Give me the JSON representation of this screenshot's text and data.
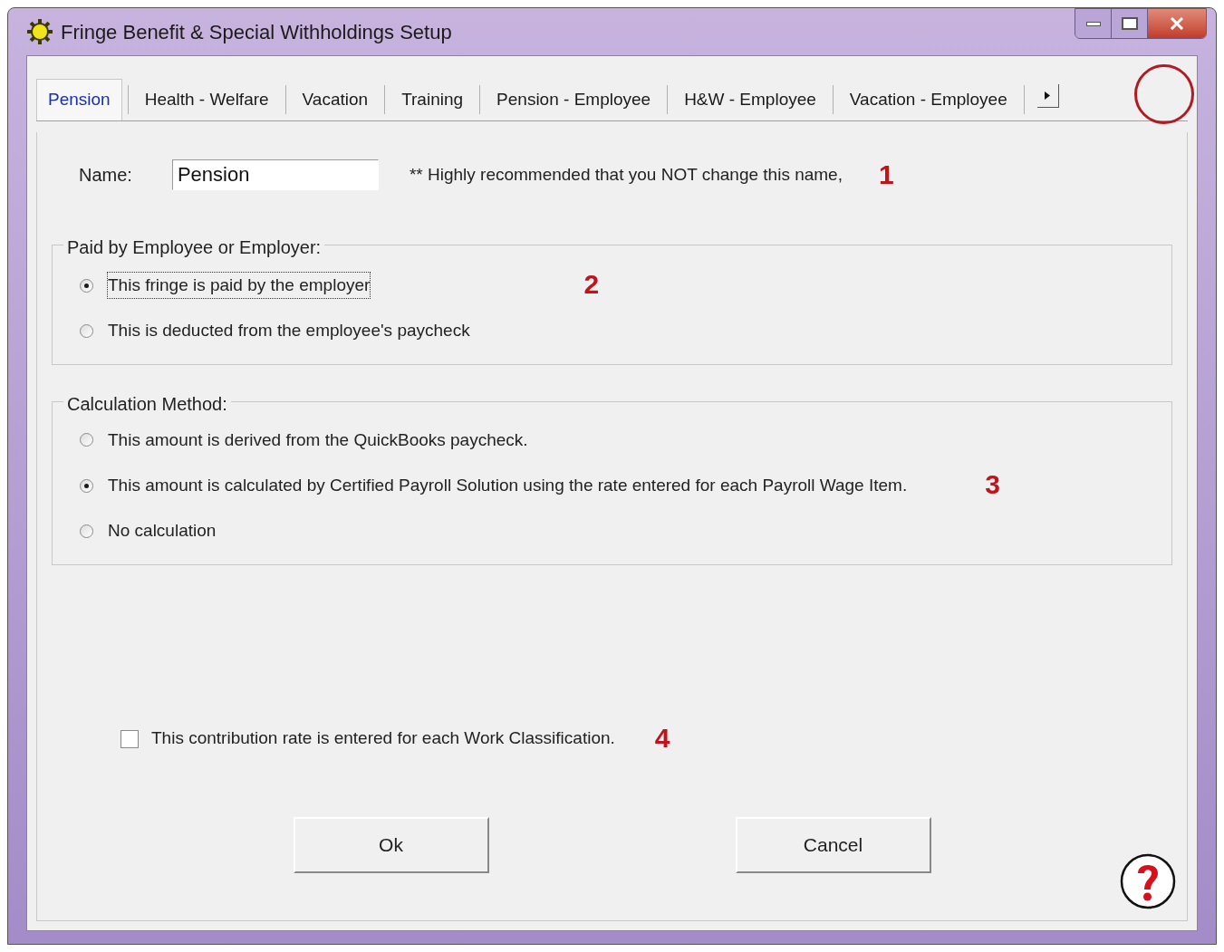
{
  "window": {
    "title": "Fringe Benefit & Special Withholdings Setup"
  },
  "tabs": [
    {
      "label": "Pension",
      "selected": true
    },
    {
      "label": "Health - Welfare",
      "selected": false
    },
    {
      "label": "Vacation",
      "selected": false
    },
    {
      "label": "Training",
      "selected": false
    },
    {
      "label": "Pension - Employee",
      "selected": false
    },
    {
      "label": "H&W - Employee",
      "selected": false
    },
    {
      "label": "Vacation - Employee",
      "selected": false
    }
  ],
  "name_field": {
    "label": "Name:",
    "value": "Pension",
    "note": "** Highly recommended that you NOT change this name,",
    "marker": "1"
  },
  "paid_by": {
    "title": "Paid by Employee or Employer:",
    "marker": "2",
    "options": [
      {
        "label": "This fringe is paid by the employer",
        "selected": true
      },
      {
        "label": "This is deducted from the employee's paycheck",
        "selected": false
      }
    ]
  },
  "calculation": {
    "title": "Calculation Method:",
    "marker": "3",
    "options": [
      {
        "label": "This amount is derived from the QuickBooks paycheck.",
        "selected": false
      },
      {
        "label": "This amount is calculated by Certified Payroll Solution using the rate entered for each Payroll Wage Item.",
        "selected": true
      },
      {
        "label": "No calculation",
        "selected": false
      }
    ]
  },
  "work_class": {
    "label": "This contribution rate is entered for each Work Classification.",
    "checked": false,
    "marker": "4"
  },
  "buttons": [
    "Ok",
    "Cancel"
  ]
}
